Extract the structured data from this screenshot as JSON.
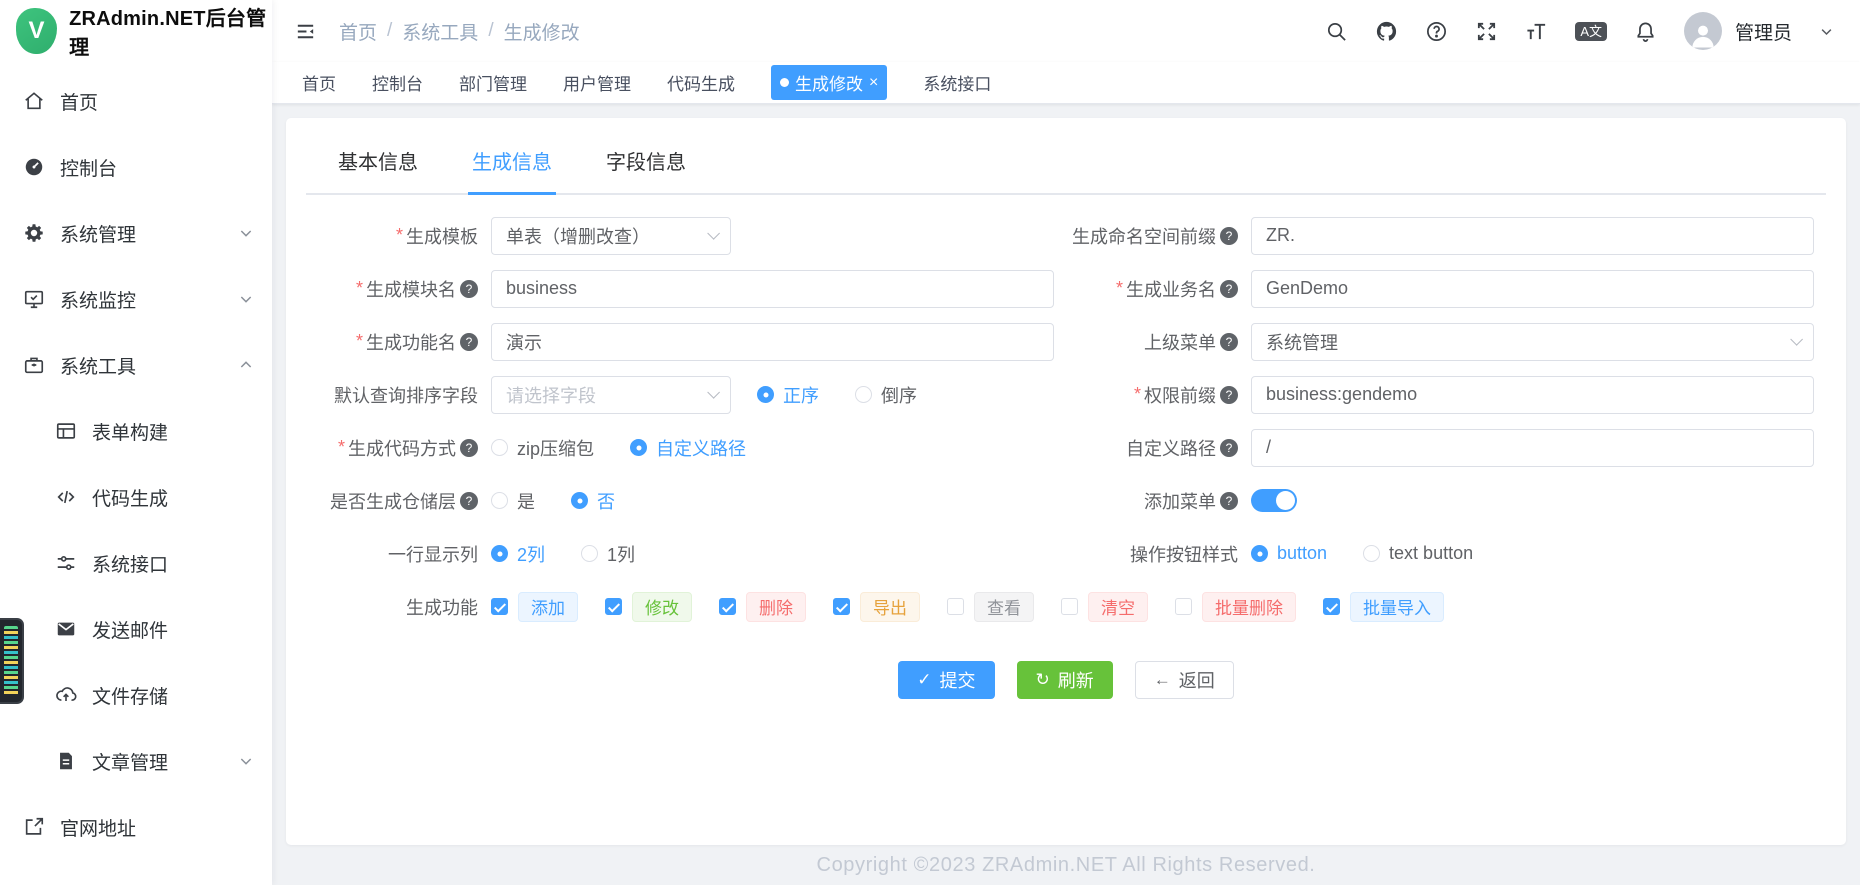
{
  "glyphs": {
    "star": "*",
    "question": "?",
    "close": "×",
    "slash": "/",
    "check": "✓",
    "refresh": "↻",
    "back_arrow": "←"
  },
  "app": {
    "title": "ZRAdmin.NET后台管理",
    "logo_letter": "V"
  },
  "sidebar": {
    "items": [
      {
        "label": "首页"
      },
      {
        "label": "控制台"
      },
      {
        "label": "系统管理"
      },
      {
        "label": "系统监控"
      },
      {
        "label": "系统工具"
      },
      {
        "label": "表单构建"
      },
      {
        "label": "代码生成"
      },
      {
        "label": "系统接口"
      },
      {
        "label": "发送邮件"
      },
      {
        "label": "文件存储"
      },
      {
        "label": "文章管理"
      },
      {
        "label": "官网地址"
      }
    ]
  },
  "navbar": {
    "breadcrumb": [
      "首页",
      "系统工具",
      "生成修改"
    ],
    "language_badge": "A文",
    "username": "管理员"
  },
  "tags": {
    "items": [
      "首页",
      "控制台",
      "部门管理",
      "用户管理",
      "代码生成",
      "生成修改",
      "系统接口"
    ],
    "active": "生成修改"
  },
  "panel": {
    "tabs": [
      "基本信息",
      "生成信息",
      "字段信息"
    ],
    "active": "生成信息"
  },
  "form": {
    "gen_template": {
      "label": "生成模板",
      "value": "单表（增删改查）"
    },
    "namespace_prefix": {
      "label": "生成命名空间前缀",
      "value": "ZR."
    },
    "module_name": {
      "label": "生成模块名",
      "value": "business"
    },
    "business_name": {
      "label": "生成业务名",
      "value": "GenDemo"
    },
    "function_name": {
      "label": "生成功能名",
      "value": "演示"
    },
    "parent_menu": {
      "label": "上级菜单",
      "value": "系统管理"
    },
    "sort_field": {
      "label": "默认查询排序字段",
      "placeholder": "请选择字段",
      "options": [
        "正序",
        "倒序"
      ],
      "selected": "正序"
    },
    "perm_prefix": {
      "label": "权限前缀",
      "value": "business:gendemo"
    },
    "code_way": {
      "label": "生成代码方式",
      "options": [
        "zip压缩包",
        "自定义路径"
      ],
      "selected": "自定义路径"
    },
    "custom_path": {
      "label": "自定义路径",
      "value": "/"
    },
    "repository": {
      "label": "是否生成仓储层",
      "options": [
        "是",
        "否"
      ],
      "selected": "否"
    },
    "add_menu": {
      "label": "添加菜单",
      "on": true
    },
    "columns": {
      "label": "一行显示列",
      "options": [
        "2列",
        "1列"
      ],
      "selected": "2列"
    },
    "btn_style": {
      "label": "操作按钮样式",
      "options": [
        "button",
        "text button"
      ],
      "selected": "button"
    },
    "functions": {
      "label": "生成功能",
      "options": [
        {
          "label": "添加",
          "checked": true,
          "color": "primary"
        },
        {
          "label": "修改",
          "checked": true,
          "color": "success"
        },
        {
          "label": "删除",
          "checked": true,
          "color": "danger"
        },
        {
          "label": "导出",
          "checked": true,
          "color": "warning"
        },
        {
          "label": "查看",
          "checked": false,
          "color": "info"
        },
        {
          "label": "清空",
          "checked": false,
          "color": "danger"
        },
        {
          "label": "批量删除",
          "checked": false,
          "color": "danger"
        },
        {
          "label": "批量导入",
          "checked": true,
          "color": "primary"
        }
      ]
    }
  },
  "actions": {
    "submit": "提交",
    "refresh": "刷新",
    "back": "返回"
  },
  "footer": {
    "copyright": "Copyright ©2023 ZRAdmin.NET All Rights Reserved."
  },
  "colors": {
    "primary": "#409eff",
    "success": "#67c23a",
    "danger": "#f56c6c",
    "warning": "#e6a23c",
    "info": "#909399"
  }
}
